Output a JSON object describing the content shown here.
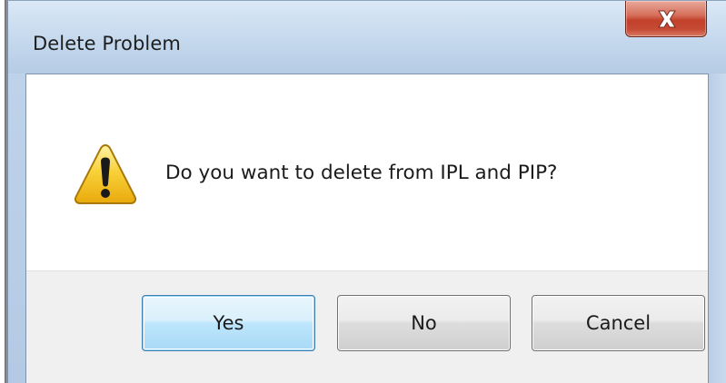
{
  "dialog": {
    "title": "Delete Problem",
    "close_glyph": "X",
    "message": "Do you want to delete from IPL and PIP?",
    "icon": "warning-icon"
  },
  "buttons": {
    "yes_label": "Yes",
    "no_label": "No",
    "cancel_label": "Cancel",
    "default_button": "Yes"
  },
  "colors": {
    "close_button": "#c7432d",
    "default_button_border": "#3c7fb1",
    "warning_fill": "#f5c518",
    "title_bar": "#c8dbef"
  }
}
